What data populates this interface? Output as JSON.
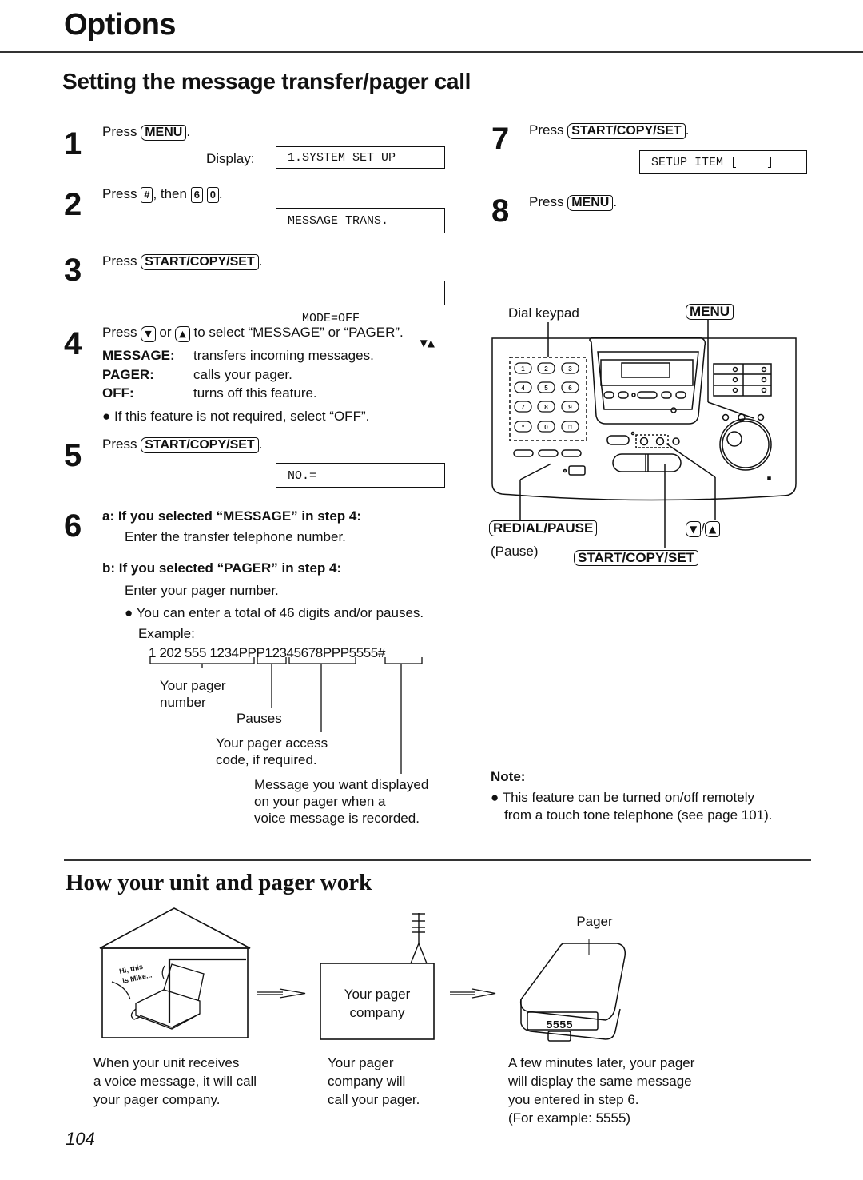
{
  "header": {
    "section_title": "Options",
    "page_title": "Setting the message transfer/pager call"
  },
  "steps": [
    {
      "num": "1",
      "press": "Press",
      "key": "MENU",
      "display_label": "Display:",
      "display": "1.SYSTEM SET UP"
    },
    {
      "num": "2",
      "press": "Press",
      "key": "#",
      "then": ", then",
      "keys": [
        "6",
        "0"
      ],
      "display": "MESSAGE TRANS."
    },
    {
      "num": "3",
      "press": "Press",
      "key": "START/COPY/SET",
      "display": "MODE=OFF",
      "display_arrows": "▼▲"
    },
    {
      "num": "4",
      "press": "Press",
      "key_down": "▼",
      "or": "or",
      "key_up": "▲",
      "rest": "to select “MESSAGE” or “PAGER”.",
      "options": [
        {
          "term": "MESSAGE:",
          "desc": "transfers incoming messages."
        },
        {
          "term": "PAGER:",
          "desc": "calls your pager."
        },
        {
          "term": "OFF:",
          "desc": "turns off this feature."
        }
      ],
      "bullet": "If this feature is not required, select “OFF”."
    },
    {
      "num": "5",
      "press": "Press",
      "key": "START/COPY/SET",
      "display": "NO.="
    },
    {
      "num": "6",
      "a_head": "a:  If you selected “MESSAGE” in step 4:",
      "a_text": "Enter the transfer telephone number.",
      "b_head": "b:  If you selected “PAGER” in step 4:",
      "b_text": "Enter your pager number.",
      "bullet": "You can enter a total of 46 digits and/or pauses.",
      "example_label": "Example:",
      "example": "1 202 555 1234PPP12345678PPP5555#",
      "annotations": {
        "pager_number": [
          "Your pager",
          "number"
        ],
        "pauses": "Pauses",
        "access_code": [
          "Your pager access",
          "code, if required."
        ],
        "message": [
          "Message you want displayed",
          "on your pager when a",
          "voice message is recorded."
        ]
      }
    },
    {
      "num": "7",
      "press": "Press",
      "key": "START/COPY/SET",
      "display": "SETUP ITEM [    ]"
    },
    {
      "num": "8",
      "press": "Press",
      "key": "MENU"
    }
  ],
  "diagram": {
    "dial_keypad": "Dial keypad",
    "menu": "MENU",
    "keypad_keys": [
      "1",
      "2",
      "3",
      "4",
      "5",
      "6",
      "7",
      "8",
      "9",
      "*",
      "0",
      "□"
    ],
    "redial": "REDIAL/PAUSE",
    "pause": "(Pause)",
    "down_up_down": "▼",
    "down_up_sep": "/",
    "down_up_up": "▲",
    "start": "START/COPY/SET"
  },
  "note": {
    "title": "Note:",
    "lines": [
      "This feature can be turned on/off remotely",
      "from a touch tone telephone (see page 101)."
    ]
  },
  "how": {
    "title": "How your unit and pager work",
    "speech": [
      "Hi, this",
      "is Mike..."
    ],
    "company": [
      "Your pager",
      "company"
    ],
    "pager_label": "Pager",
    "pager_display": "5555",
    "captions": [
      [
        "When your unit receives",
        "a voice message, it will call",
        "your pager company."
      ],
      [
        "Your pager",
        "company will",
        "call your pager."
      ],
      [
        "A few minutes later, your pager",
        "will display the same message",
        "you entered in step 6.",
        "(For example: 5555)"
      ]
    ]
  },
  "footer": {
    "page_number": "104"
  }
}
